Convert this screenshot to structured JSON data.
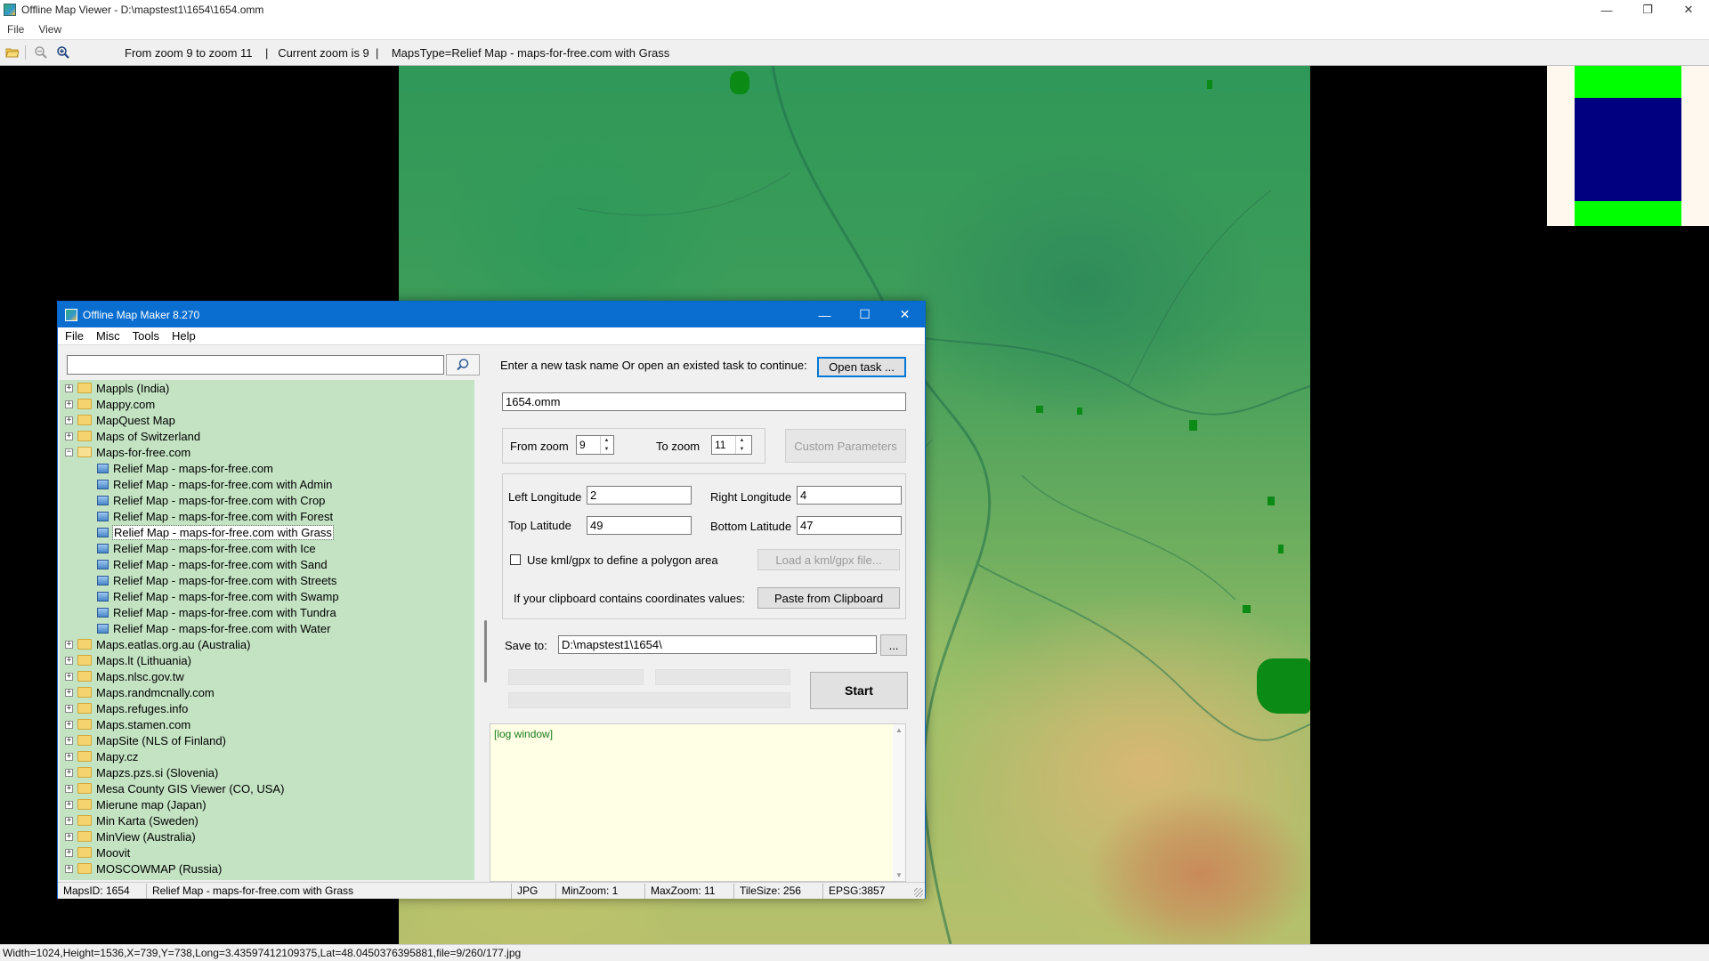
{
  "viewer": {
    "title": "Offline Map Viewer - D:\\mapstest1\\1654\\1654.omm",
    "menu": [
      "File",
      "View"
    ],
    "toolbar_text": "From zoom 9 to zoom 11    |   Current zoom is 9  |    MapsType=Relief Map - maps-for-free.com with Grass",
    "status_text": "Width=1024,Height=1536,X=739,Y=738,Long=3.43597412109375,Lat=48.0450376395881,file=9/260/177.jpg",
    "win_ctrls": {
      "minimize": "—",
      "maximize": "❐",
      "close": "✕"
    }
  },
  "dialog": {
    "title": "Offline Map Maker 8.270",
    "menu": [
      "File",
      "Misc",
      "Tools",
      "Help"
    ],
    "search": {
      "value": "",
      "icon": "search-icon"
    },
    "tree": [
      {
        "label": "Mappls (India)",
        "type": "folder",
        "expanded": false
      },
      {
        "label": "Mappy.com",
        "type": "folder",
        "expanded": false
      },
      {
        "label": "MapQuest Map",
        "type": "folder",
        "expanded": false
      },
      {
        "label": "Maps of Switzerland",
        "type": "folder",
        "expanded": false
      },
      {
        "label": "Maps-for-free.com",
        "type": "folder",
        "expanded": true
      },
      {
        "label": "Relief Map - maps-for-free.com",
        "type": "map"
      },
      {
        "label": "Relief Map - maps-for-free.com with Admin",
        "type": "map"
      },
      {
        "label": "Relief Map - maps-for-free.com with Crop",
        "type": "map"
      },
      {
        "label": "Relief Map - maps-for-free.com with Forest",
        "type": "map"
      },
      {
        "label": "Relief Map - maps-for-free.com with Grass",
        "type": "map",
        "selected": true
      },
      {
        "label": "Relief Map - maps-for-free.com with Ice",
        "type": "map"
      },
      {
        "label": "Relief Map - maps-for-free.com with Sand",
        "type": "map"
      },
      {
        "label": "Relief Map - maps-for-free.com with Streets",
        "type": "map"
      },
      {
        "label": "Relief Map - maps-for-free.com with Swamp",
        "type": "map"
      },
      {
        "label": "Relief Map - maps-for-free.com with Tundra",
        "type": "map"
      },
      {
        "label": "Relief Map - maps-for-free.com with Water",
        "type": "map"
      },
      {
        "label": "Maps.eatlas.org.au (Australia)",
        "type": "folder",
        "expanded": false
      },
      {
        "label": "Maps.lt (Lithuania)",
        "type": "folder",
        "expanded": false
      },
      {
        "label": "Maps.nlsc.gov.tw",
        "type": "folder",
        "expanded": false
      },
      {
        "label": "Maps.randmcnally.com",
        "type": "folder",
        "expanded": false
      },
      {
        "label": "Maps.refuges.info",
        "type": "folder",
        "expanded": false
      },
      {
        "label": "Maps.stamen.com",
        "type": "folder",
        "expanded": false
      },
      {
        "label": "MapSite (NLS of Finland)",
        "type": "folder",
        "expanded": false
      },
      {
        "label": "Mapy.cz",
        "type": "folder",
        "expanded": false
      },
      {
        "label": "Mapzs.pzs.si (Slovenia)",
        "type": "folder",
        "expanded": false
      },
      {
        "label": "Mesa County GIS Viewer (CO, USA)",
        "type": "folder",
        "expanded": false
      },
      {
        "label": "Mierune map (Japan)",
        "type": "folder",
        "expanded": false
      },
      {
        "label": "Min Karta (Sweden)",
        "type": "folder",
        "expanded": false
      },
      {
        "label": "MinView (Australia)",
        "type": "folder",
        "expanded": false
      },
      {
        "label": "Moovit",
        "type": "folder",
        "expanded": false
      },
      {
        "label": "MOSCOWMAP (Russia)",
        "type": "folder",
        "expanded": false
      }
    ],
    "task_prompt": "Enter a new task name Or open an existed task to continue:",
    "open_task_label": "Open task ...",
    "task_name": "1654.omm",
    "from_zoom_label": "From zoom",
    "from_zoom_value": "9",
    "to_zoom_label": "To zoom",
    "to_zoom_value": "11",
    "custom_params_label": "Custom Parameters",
    "left_lon_label": "Left Longitude",
    "left_lon_value": "2",
    "right_lon_label": "Right Longitude",
    "right_lon_value": "4",
    "top_lat_label": "Top Latitude",
    "top_lat_value": "49",
    "bottom_lat_label": "Bottom Latitude",
    "bottom_lat_value": "47",
    "kml_checkbox_label": "Use kml/gpx to define a polygon area",
    "kml_checked": false,
    "load_kml_label": "Load a kml/gpx file...",
    "clipboard_label": "If your clipboard contains coordinates values:",
    "paste_label": "Paste from Clipboard",
    "save_to_label": "Save to:",
    "save_to_value": "D:\\mapstest1\\1654\\",
    "browse_label": "...",
    "start_label": "Start",
    "log_text": "[log window]",
    "status": {
      "maps_id": "MapsID: 1654",
      "map_name": "Relief Map - maps-for-free.com with Grass",
      "format": "JPG",
      "min_zoom": "MinZoom: 1",
      "max_zoom": "MaxZoom: 11",
      "tile_size": "TileSize: 256",
      "epsg": "EPSG:3857"
    },
    "win_ctrls": {
      "minimize": "—",
      "maximize": "☐",
      "close": "✕"
    }
  }
}
